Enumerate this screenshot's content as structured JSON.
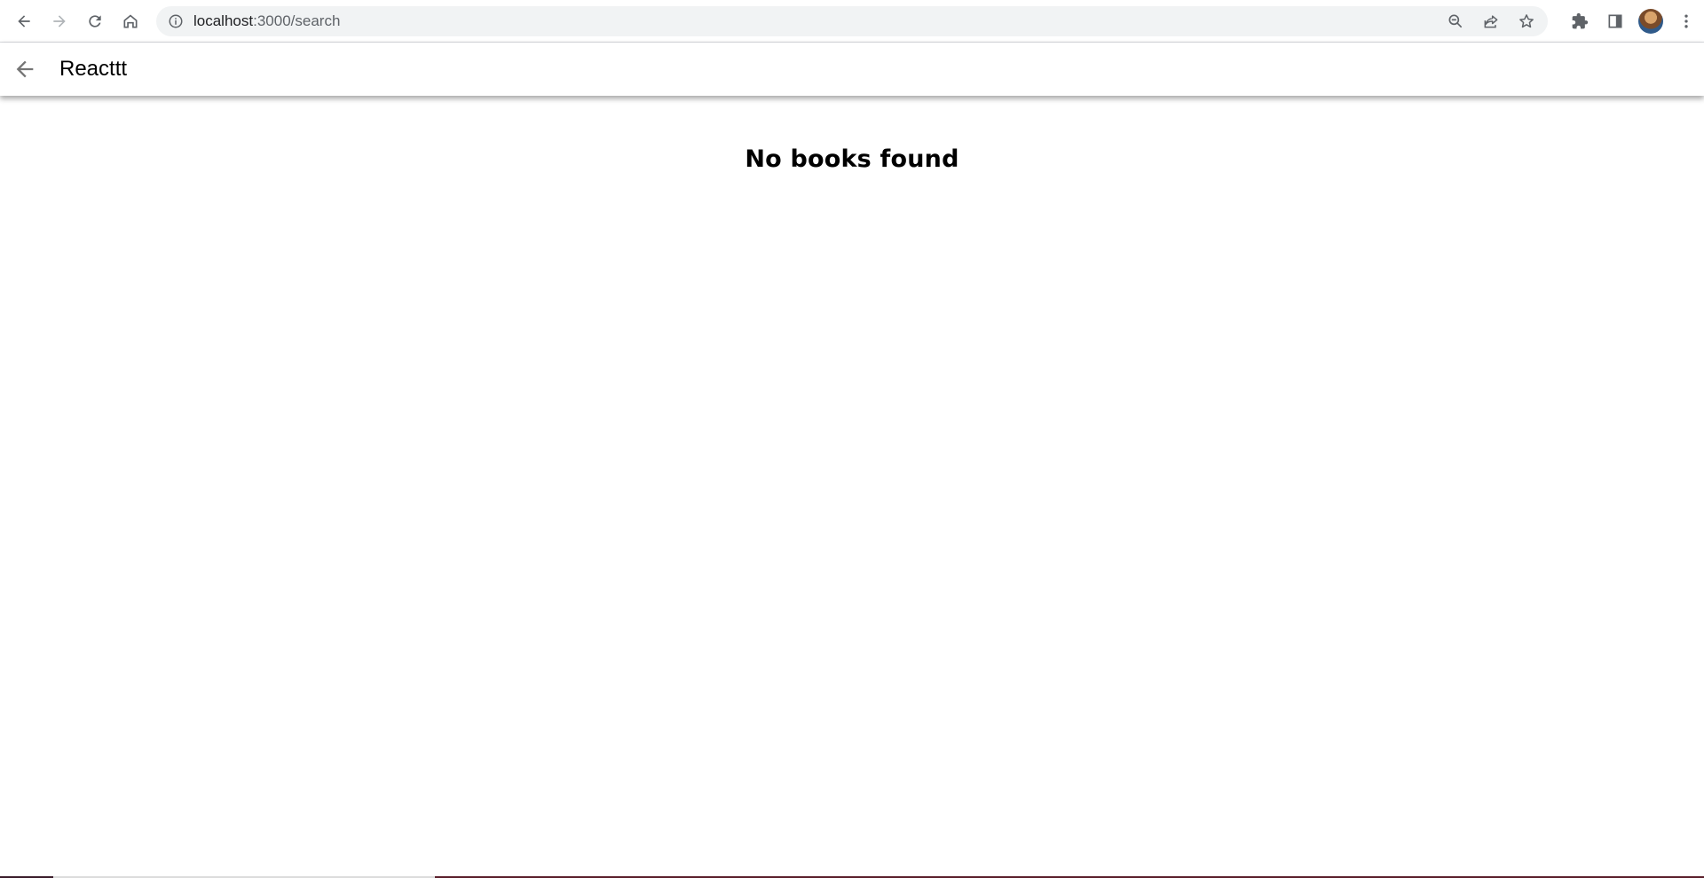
{
  "browser": {
    "url_host": "localhost",
    "url_path": ":3000/search",
    "icons": {
      "back": "arrow-left-icon",
      "forward": "arrow-right-icon",
      "reload": "reload-icon",
      "home": "home-icon",
      "site_info": "info-icon",
      "zoom": "zoom-out-icon",
      "share": "share-icon",
      "bookmark": "star-icon",
      "extensions": "puzzle-icon",
      "side_panel": "side-panel-icon",
      "menu": "kebab-menu-icon"
    }
  },
  "search_bar": {
    "query": "Reacttt",
    "back_icon": "arrow-left-icon"
  },
  "results": {
    "empty_message": "No books found"
  },
  "colors": {
    "header_bg": "#ffffff",
    "omnibox_bg": "#f1f3f4",
    "icon_color": "#5f6368",
    "text": "#000000"
  }
}
